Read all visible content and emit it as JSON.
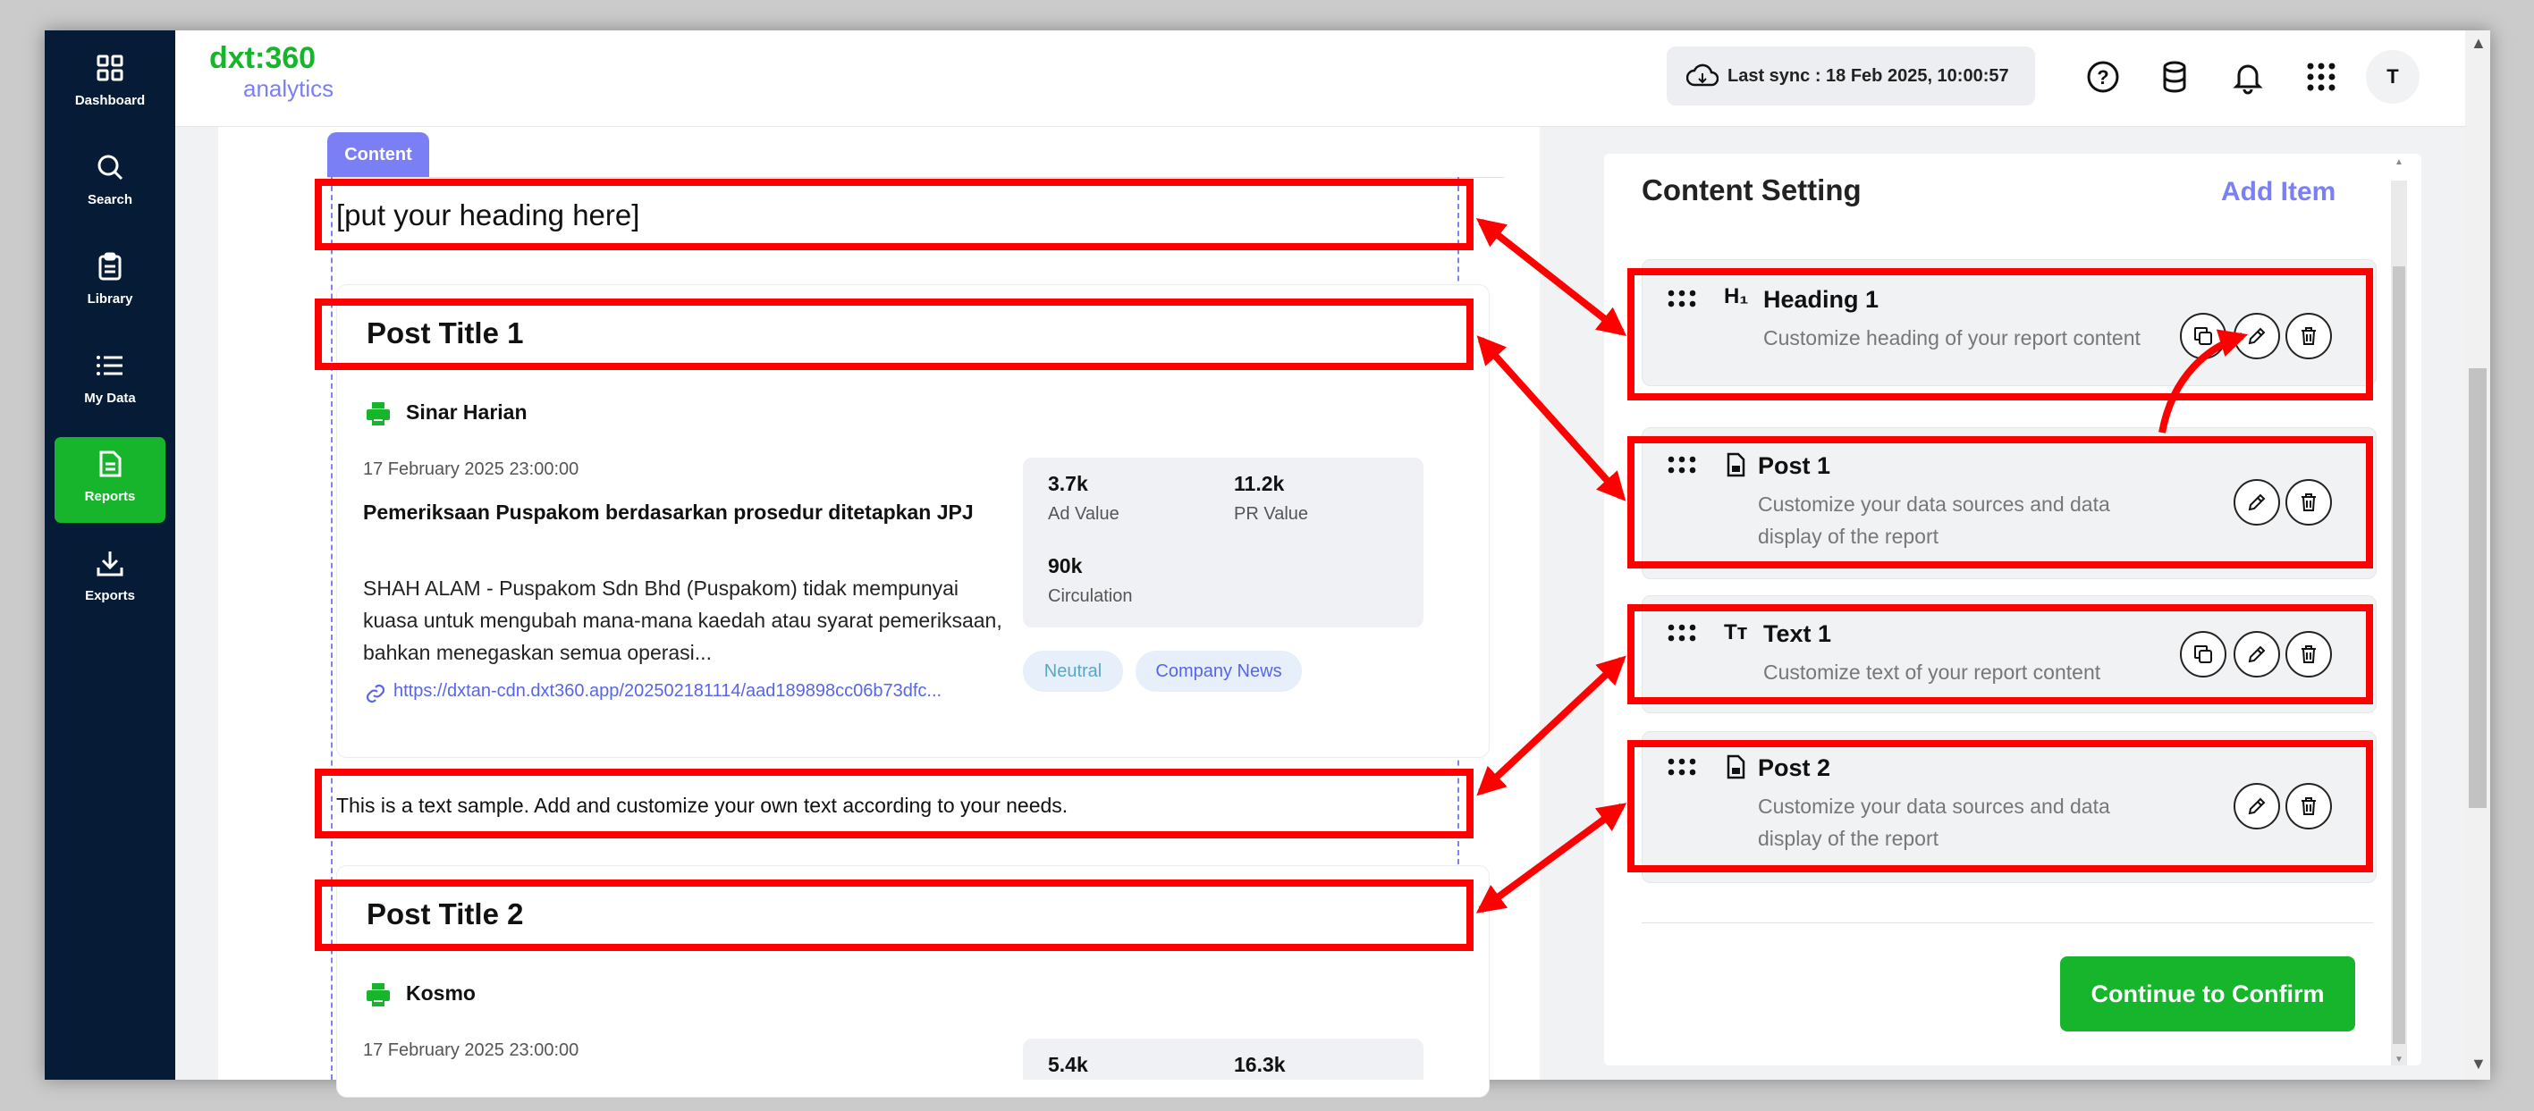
{
  "app": {
    "logo_line1": "dxt:360",
    "logo_line2": "analytics"
  },
  "sidebar": {
    "items": [
      {
        "label": "Dashboard",
        "icon": "grid-icon",
        "active": false
      },
      {
        "label": "Search",
        "icon": "search-icon",
        "active": false
      },
      {
        "label": "Library",
        "icon": "clipboard-icon",
        "active": false
      },
      {
        "label": "My Data",
        "icon": "list-icon",
        "active": false
      },
      {
        "label": "Reports",
        "icon": "report-icon",
        "active": true
      },
      {
        "label": "Exports",
        "icon": "download-icon",
        "active": false
      }
    ]
  },
  "header": {
    "sync_text": "Last sync : 18 Feb 2025, 10:00:57",
    "icons": [
      "cloud-sync-icon",
      "help-icon",
      "database-icon",
      "bell-icon",
      "apps-grid-icon"
    ],
    "avatar_initial": "T"
  },
  "canvas": {
    "tab_label": "Content",
    "heading_placeholder": "[put your heading here]",
    "text_sample": "This is a text sample. Add and customize your own text according to your needs.",
    "posts": [
      {
        "title": "Post Title 1",
        "publication": "Sinar Harian",
        "date": "17 February 2025 23:00:00",
        "headline": "Pemeriksaan Puspakom berdasarkan prosedur ditetapkan JPJ",
        "body": "SHAH ALAM - Puspakom Sdn Bhd (Puspakom) tidak mempunyai kuasa untuk mengubah mana-mana kaedah atau syarat pemeriksaan, bahkan menegaskan semua operasi...",
        "link": "https://dxtan-cdn.dxt360.app/202502181114/aad189898cc06b73dfc...",
        "ad_value": "3.7k",
        "ad_value_label": "Ad Value",
        "pr_value": "11.2k",
        "pr_value_label": "PR Value",
        "circulation": "90k",
        "circulation_label": "Circulation",
        "tags": [
          "Neutral",
          "Company News"
        ]
      },
      {
        "title": "Post Title 2",
        "publication": "Kosmo",
        "date": "17 February 2025 23:00:00",
        "ad_value": "5.4k",
        "pr_value": "16.3k"
      }
    ]
  },
  "panel": {
    "title": "Content Setting",
    "add_item": "Add Item",
    "items": [
      {
        "icon_glyph": "H₁",
        "icon": "heading-icon",
        "title": "Heading 1",
        "desc": "Customize heading of your report content",
        "actions": [
          "copy-icon",
          "edit-icon",
          "delete-icon"
        ]
      },
      {
        "icon_glyph": "▤",
        "icon": "document-icon",
        "title": "Post 1",
        "desc": "Customize your data sources and data display of the report",
        "actions": [
          "edit-icon",
          "delete-icon"
        ]
      },
      {
        "icon_glyph": "Tт",
        "icon": "text-icon",
        "title": "Text 1",
        "desc": "Customize text of your report content",
        "actions": [
          "copy-icon",
          "edit-icon",
          "delete-icon"
        ]
      },
      {
        "icon_glyph": "▤",
        "icon": "document-icon",
        "title": "Post 2",
        "desc": "Customize your data sources and data display of the report",
        "actions": [
          "edit-icon",
          "delete-icon"
        ]
      }
    ],
    "continue_label": "Continue to Confirm"
  },
  "colors": {
    "sidebar_bg": "#051b36",
    "active_green": "#16b52c",
    "accent_purple": "#7b7ff5",
    "annotation_red": "#ff0000",
    "link_blue": "#5865e8"
  }
}
